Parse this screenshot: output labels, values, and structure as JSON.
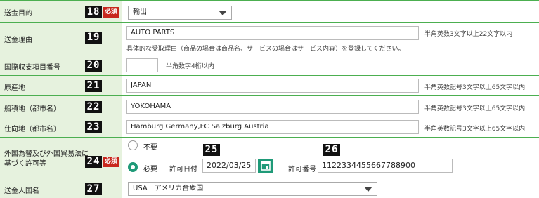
{
  "rows": {
    "purpose": {
      "label": "送金目的",
      "num": "18",
      "required": "必須",
      "value": "輸出"
    },
    "reason": {
      "label": "送金理由",
      "num": "19",
      "value": "AUTO PARTS",
      "hint": "半角英数3文字以上22文字以内",
      "note": "具体的な受取理由（商品の場合は商品名、サービスの場合はサービス内容）を登録してください。"
    },
    "balance": {
      "label": "国際収支項目番号",
      "num": "20",
      "value": "",
      "hint": "半角数字4桁以内"
    },
    "origin": {
      "label": "原産地",
      "num": "21",
      "value": "JAPAN",
      "hint": "半角英数記号3文字以上65文字以内"
    },
    "shipping": {
      "label": "船積地（都市名）",
      "num": "22",
      "value": "YOKOHAMA",
      "hint": "半角英数記号3文字以上65文字以内"
    },
    "destination": {
      "label": "仕向地（都市名）",
      "num": "23",
      "value": "Hamburg Germany,FC Salzburg Austria",
      "hint": "半角英数記号3文字以上65文字以内"
    },
    "permit": {
      "label_line1": "外国為替及び外国貿易法に",
      "label_line2": "基づく許可等",
      "num": "24",
      "required": "必須",
      "option_no": "不要",
      "option_yes": "必要",
      "date_label": "許可日付",
      "date_num": "25",
      "date_value": "2022/03/25",
      "permit_label": "許可番号",
      "permit_num": "26",
      "permit_value": "1122334455667788900"
    },
    "country": {
      "label": "送金人国名",
      "num": "27",
      "value": "USA　アメリカ合衆国"
    }
  },
  "colors": {
    "border": "#4caf50",
    "label_bg": "#e6f2de",
    "required": "#c8281e",
    "accent": "#1f9a78"
  }
}
